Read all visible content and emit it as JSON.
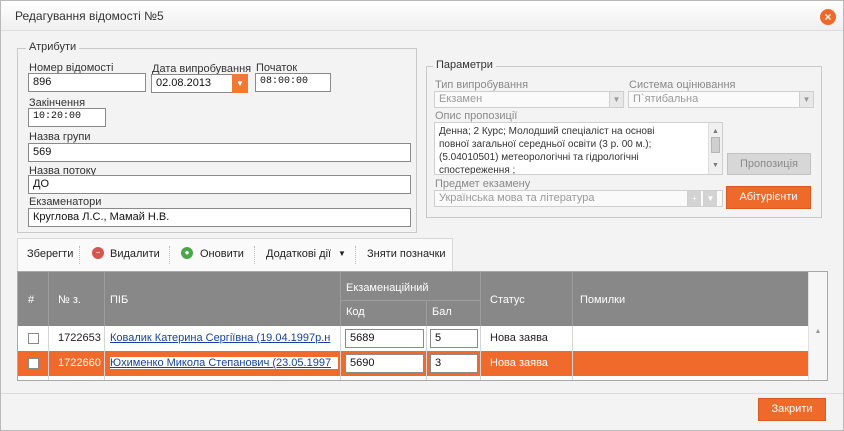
{
  "dialog": {
    "title": "Редагування відомості №5",
    "close_glyph": "×",
    "colors": {
      "accent": "#ee6a2b",
      "header": "#888888"
    }
  },
  "attributes": {
    "legend": "Атрибути",
    "number_label": "Номер відомості",
    "number_value": "896",
    "date_label": "Дата випробування",
    "date_value": "02.08.2013",
    "start_label": "Початок",
    "start_value": "08:00:00",
    "end_label": "Закінчення",
    "end_value": "10:20:00",
    "group_label": "Назва групи",
    "group_value": "569",
    "stream_label": "Назва потоку",
    "stream_value": "ДО",
    "examiners_label": "Екзаменатори",
    "examiners_value": "Круглова Л.С., Мамай Н.В."
  },
  "parameters": {
    "legend": "Параметри",
    "test_type_label": "Тип випробування",
    "test_type_value": "Екзамен",
    "grading_label": "Система оцінювання",
    "grading_value": "П`ятибальна",
    "proposal_desc_label": "Опис пропозиції",
    "proposal_desc_lines": [
      "Денна; 2 Курс; Молодший спеціаліст на основі",
      "повної загальної середньої освіти (3 р. 00 м.);",
      "(5.04010501) метеорологічні та гідрологічні",
      "спостереження   ;"
    ],
    "proposal_button": "Пропозиція",
    "subject_label": "Предмет екзамену",
    "subject_value": "Українська мова та література",
    "applicants_button": "Абітурієнти"
  },
  "toolbar": {
    "save": "Зберегти",
    "delete": "Видалити",
    "refresh": "Оновити",
    "extra": "Додаткові дії",
    "unmark": "Зняти позначки"
  },
  "grid": {
    "columns": {
      "hash": "#",
      "number": "№ з.",
      "name": "ПІБ",
      "exam": "Екзаменаційний",
      "code": "Код",
      "score": "Бал",
      "status": "Статус",
      "errors": "Помилки"
    },
    "rows": [
      {
        "number": "1722653",
        "name": "Ковалик Катерина Сергіївна (19.04.1997р.н",
        "code": "5689",
        "score": "5",
        "status": "Нова заява",
        "selected": false
      },
      {
        "number": "1722660",
        "name": "Юхименко Микола Степанович (23.05.1997",
        "code": "5690",
        "score": "3",
        "status": "Нова заява",
        "selected": true
      }
    ]
  },
  "footer": {
    "close_button": "Закрити"
  }
}
